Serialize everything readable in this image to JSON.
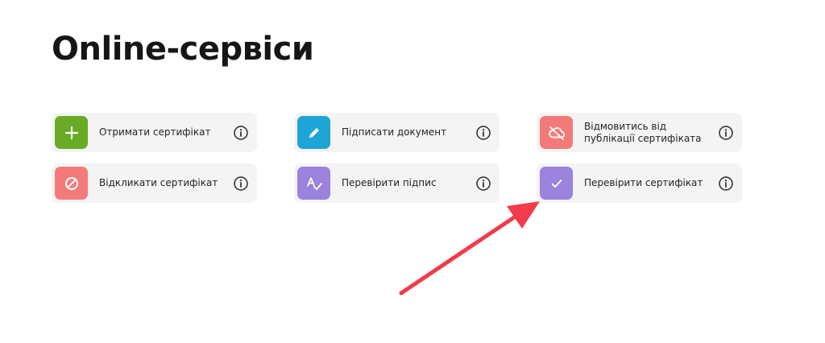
{
  "header": {
    "title": "Online-сервіси"
  },
  "services": [
    {
      "id": "get-certificate",
      "label": "Отримати сертифікат",
      "icon": "plus-icon",
      "color": "#6aab26"
    },
    {
      "id": "sign-document",
      "label": "Підписати документ",
      "icon": "pencil-icon",
      "color": "#1ea5d6"
    },
    {
      "id": "refuse-publication",
      "label": "Відмовитись від публікації сертифіката",
      "icon": "cloud-off-icon",
      "color": "#f47a7a"
    },
    {
      "id": "revoke-certificate",
      "label": "Відкликати сертифікат",
      "icon": "block-icon",
      "color": "#f47a7a"
    },
    {
      "id": "verify-signature",
      "label": "Перевірити підпис",
      "icon": "spellcheck-icon",
      "color": "#9a82dd"
    },
    {
      "id": "verify-certificate",
      "label": "Перевірити сертифікат",
      "icon": "check-icon",
      "color": "#9a82dd"
    }
  ],
  "info_icon": "info-icon",
  "annotation": {
    "icon": "arrow-pointer-icon",
    "color": "#f23b4b",
    "target": "verify-certificate"
  }
}
